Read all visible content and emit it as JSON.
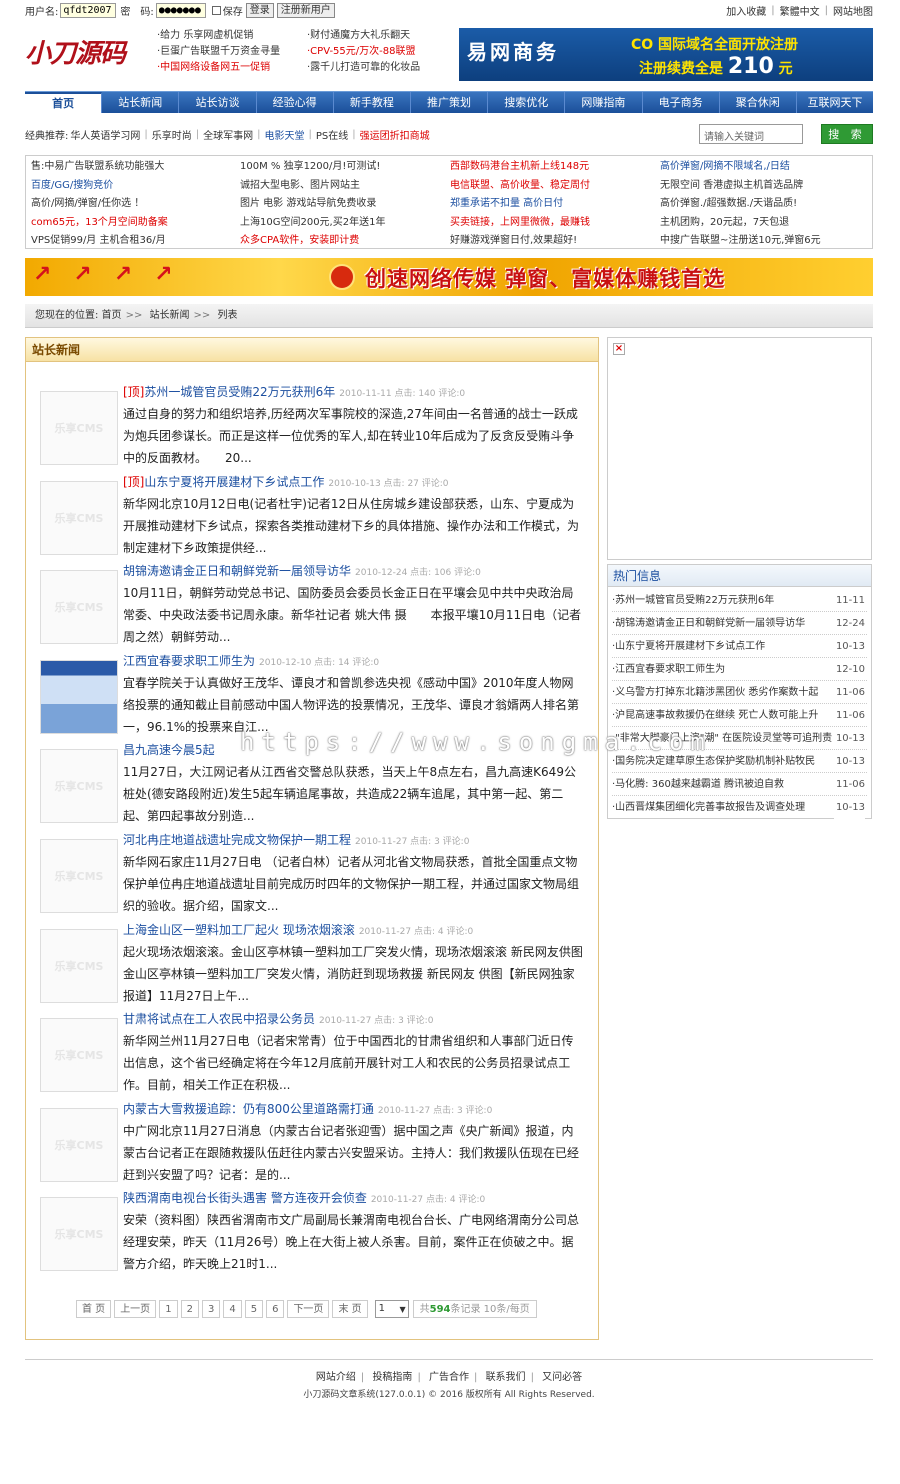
{
  "topbar": {
    "user_label": "用户名:",
    "user_value": "qfdt2007",
    "pwd_label": "密　码:",
    "pwd_value": "●●●●●●●",
    "save_label": "保存",
    "login_label": "登录",
    "register_label": "注册新用户",
    "nav": [
      "加入收藏",
      "繁體中文",
      "网站地图"
    ]
  },
  "logo": "小刀源码",
  "header_ads": {
    "col1": [
      "·给力 乐享网虚机促销",
      "·巨蛋广告联盟千万资金寻量",
      "·中国网络设备网五一促销"
    ],
    "col2": [
      "·财付通魔方大礼乐翻天",
      "·CPV-55元/万次-88联盟",
      "·露千儿打造可靠的化妆品"
    ]
  },
  "banner1": {
    "left": "易网商务",
    "right1": "CO 国际域名全面开放注册",
    "right2_pre": "注册续费全是 ",
    "right2_num": "210",
    "right2_post": " 元"
  },
  "menu": [
    "首页",
    "站长新闻",
    "站长访谈",
    "经验心得",
    "新手教程",
    "推广策划",
    "搜索优化",
    "网赚指南",
    "电子商务",
    "聚合休闲",
    "互联网天下"
  ],
  "recommend": {
    "label": "经典推荐:",
    "items": [
      "华人英语学习网",
      "乐享时尚",
      "全球军事网",
      "电影天堂",
      "PS在线",
      "强运团折扣商城"
    ]
  },
  "search": {
    "placeholder": "请输入关键词",
    "button": "搜 索"
  },
  "text_ads": {
    "col1": [
      "售:中易广告联盟系统功能强大",
      "百度/GG/搜狗竞价",
      "高价/网摘/弹窗/任你选 ！",
      "com65元，13个月空间助备案",
      "VPS促销99/月 主机合租36/月"
    ],
    "col2": [
      "100M % 独享1200/月!可测试!",
      "诚招大型电影、图片网站主",
      "图片 电影 游戏站导航免费收录",
      "上海10G空间200元,买2年送1年",
      "众多CPA软件，安装即计费"
    ],
    "col3": [
      "西部数码港台主机新上线148元",
      "电信联盟、高价收量、稳定周付",
      "郑重承诺不扣量 高价日付",
      "买卖链接，上网里微微，最赚钱",
      "好赚游戏弹窗日付,效果超好!"
    ],
    "col4": [
      "高价弹窗/网摘不限域名,/日结",
      "无限空间 香港虚拟主机首选品牌",
      "高价弹窗./超强数据./天谐品质!",
      "主机团购，20元起，7天包退",
      "中搜广告联盟~注册送10元,弹窗6元"
    ]
  },
  "banner2": {
    "text": "创速网络传媒  弹窗、富媒体赚钱首选"
  },
  "breadcrumb": {
    "label": "您现在的位置:",
    "items": [
      "首页",
      "站长新闻",
      "列表"
    ]
  },
  "main": {
    "heading": "站长新闻",
    "thumb_text": "乐享CMS",
    "articles": [
      {
        "tag": "[顶]",
        "title": "苏州一城管官员受贿22万元获刑6年",
        "meta": "2010-11-11 点击: 140 评论:0",
        "summary": "通过自身的努力和组织培养,历经两次军事院校的深造,27年间由一名普通的战士一跃成为炮兵团参谋长。而正是这样一位优秀的军人,却在转业10年后成为了反贪反受贿斗争中的反面教材。　　20..."
      },
      {
        "tag": "[顶]",
        "title": "山东宁夏将开展建材下乡试点工作",
        "meta": "2010-10-13 点击: 27 评论:0",
        "summary": "新华网北京10月12日电(记者杜宇)记者12日从住房城乡建设部获悉，山东、宁夏成为开展推动建材下乡试点，探索各类推动建材下乡的具体措施、操作办法和工作模式，为制定建材下乡政策提供经..."
      },
      {
        "tag": "",
        "title": "胡锦涛邀请金正日和朝鲜党新一届领导访华",
        "meta": "2010-12-24 点击: 106 评论:0",
        "summary": "10月11日，朝鲜劳动党总书记、国防委员会委员长金正日在平壤会见中共中央政治局常委、中央政法委书记周永康。新华社记者 姚大伟 摄　　本报平壤10月11日电（记者周之然）朝鲜劳动..."
      },
      {
        "tag": "",
        "title": "江西宜春要求职工师生为",
        "meta": "2010-12-10 点击: 14 评论:0",
        "summary": "宜春学院关于认真做好王茂华、谭良才和曾凯参选央视《感动中国》2010年度人物网络投票的通知截止目前感动中国人物评选的投票情况，王茂华、谭良才翁婿两人排名第一，96.1%的投票来自江..."
      },
      {
        "tag": "",
        "title": "昌九高速今晨5起",
        "meta": "",
        "summary": "11月27日，大江网记者从江西省交警总队获悉，当天上午8点左右，昌九高速K649公桩处(德安路段附近)发生5起车辆追尾事故，共造成22辆车追尾，其中第一起、第二起、第四起事故分别造..."
      },
      {
        "tag": "",
        "title": "河北冉庄地道战遗址完成文物保护一期工程",
        "meta": "2010-11-27 点击: 3 评论:0",
        "summary": "新华网石家庄11月27日电 （记者白林）记者从河北省文物局获悉，首批全国重点文物保护单位冉庄地道战遗址目前完成历时四年的文物保护一期工程，并通过国家文物局组织的验收。据介绍，国家文..."
      },
      {
        "tag": "",
        "title": "上海金山区一塑料加工厂起火 现场浓烟滚滚",
        "meta": "2010-11-27 点击: 4 评论:0",
        "summary": "起火现场浓烟滚滚。金山区亭林镇一塑料加工厂突发火情，现场浓烟滚滚 新民网友供图金山区亭林镇一塑料加工厂突发火情，消防赶到现场救援 新民网友 供图【新民网独家报道】11月27日上午..."
      },
      {
        "tag": "",
        "title": "甘肃将试点在工人农民中招录公务员",
        "meta": "2010-11-27 点击: 3 评论:0",
        "summary": "新华网兰州11月27日电（记者宋常青）位于中国西北的甘肃省组织和人事部门近日传出信息，这个省已经确定将在今年12月底前开展针对工人和农民的公务员招录试点工作。目前，相关工作正在积极..."
      },
      {
        "tag": "",
        "title": "内蒙古大雪救援追踪：仍有800公里道路需打通",
        "meta": "2010-11-27 点击: 3 评论:0",
        "summary": "中广网北京11月27日消息（内蒙古台记者张迎雪）据中国之声《央广新闻》报道，内蒙古台记者正在跟随救援队伍赶往内蒙古兴安盟采访。主持人：我们救援队伍现在已经赶到兴安盟了吗？记者：是的..."
      },
      {
        "tag": "",
        "title": "陕西渭南电视台长街头遇害 警方连夜开会侦查",
        "meta": "2010-11-27 点击: 4 评论:0",
        "summary": "安荣（资料图）陕西省渭南市文广局副局长兼渭南电视台台长、广电网络渭南分公司总经理安荣，昨天（11月26号）晚上在大街上被人杀害。目前，案件正在侦破之中。据警方介绍，昨天晚上21时1..."
      }
    ]
  },
  "pager": {
    "items": [
      "首 页",
      "上一页",
      "1",
      "2",
      "3",
      "4",
      "5",
      "6",
      "下一页",
      "末 页"
    ],
    "select": "1",
    "total_pre": "共",
    "total_num": "594",
    "total_post": "条记录 10条/每页"
  },
  "hot": {
    "heading": "热门信息",
    "items": [
      {
        "t": "·苏州一城管官员受贿22万元获刑6年",
        "d": "11-11"
      },
      {
        "t": "·胡锦涛邀请金正日和朝鲜党新一届领导访华",
        "d": "12-24"
      },
      {
        "t": "·山东宁夏将开展建材下乡试点工作",
        "d": "10-13"
      },
      {
        "t": "·江西宜春要求职工师生为",
        "d": "12-10"
      },
      {
        "t": "·义乌警方打掉东北籍涉黑团伙 悉劣作案数十起",
        "d": "11-06"
      },
      {
        "t": "·沪昆高速事故救援仍在继续 死亡人数可能上升",
        "d": "11-06"
      },
      {
        "t": "·\"非常大脚豪门上演\"潮\" 在医院设灵堂等可追刑责",
        "d": "10-13"
      },
      {
        "t": "·国务院决定建草原生态保护奖励机制补贴牧民",
        "d": "10-13"
      },
      {
        "t": "·马化腾: 360越来越霸道 腾讯被迫自救",
        "d": "11-06"
      },
      {
        "t": "·山西晋煤集团细化完善事故报告及调查处理",
        "d": "10-13"
      }
    ]
  },
  "watermark": "https://www.songma.com",
  "footer": {
    "links": [
      "网站介绍",
      "投稿指南",
      "广告合作",
      "联系我们",
      "又问必答"
    ],
    "copy": "小刀源码文章系统(127.0.0.1) © 2016 版权所有 All Rights Reserved."
  }
}
